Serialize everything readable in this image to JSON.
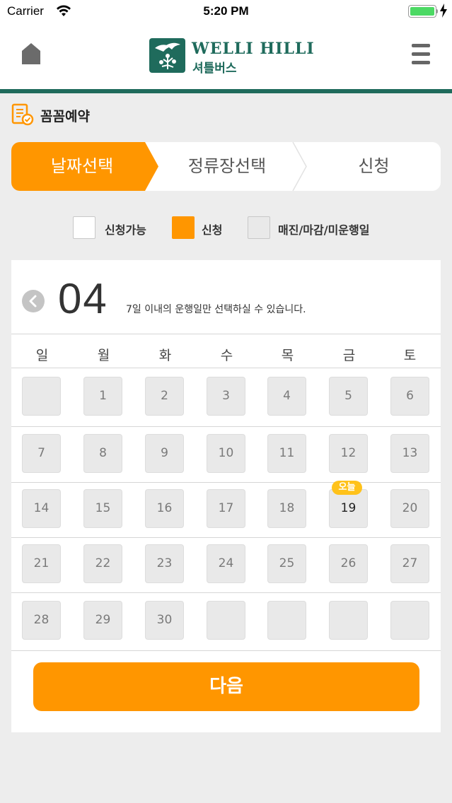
{
  "status_bar": {
    "carrier": "Carrier",
    "time": "5:20 PM"
  },
  "header": {
    "logo_title": "WELLI HILLI",
    "logo_subtitle": "셔틀버스",
    "brand_color": "#1f6b5c"
  },
  "section": {
    "title": "꼼꼼예약"
  },
  "steps": [
    {
      "label": "날짜선택",
      "active": true
    },
    {
      "label": "정류장선택",
      "active": false
    },
    {
      "label": "신청",
      "active": false
    }
  ],
  "legend": [
    {
      "label": "신청가능",
      "color": "#ffffff"
    },
    {
      "label": "신청",
      "color": "#ff9600"
    },
    {
      "label": "매진/마감/미운행일",
      "color": "#e9e9e9"
    }
  ],
  "calendar": {
    "month": "04",
    "notice": "7일 이내의 운행일만 선택하실 수 있습니다.",
    "weekdays": [
      "일",
      "월",
      "화",
      "수",
      "목",
      "금",
      "토"
    ],
    "weeks": [
      [
        "",
        "1",
        "2",
        "3",
        "4",
        "5",
        "6"
      ],
      [
        "7",
        "8",
        "9",
        "10",
        "11",
        "12",
        "13"
      ],
      [
        "14",
        "15",
        "16",
        "17",
        "18",
        "19",
        "20"
      ],
      [
        "21",
        "22",
        "23",
        "24",
        "25",
        "26",
        "27"
      ],
      [
        "28",
        "29",
        "30",
        "",
        "",
        "",
        ""
      ]
    ],
    "today": "19",
    "today_label": "오늘"
  },
  "next_button": "다음",
  "accent_color": "#ff9600"
}
